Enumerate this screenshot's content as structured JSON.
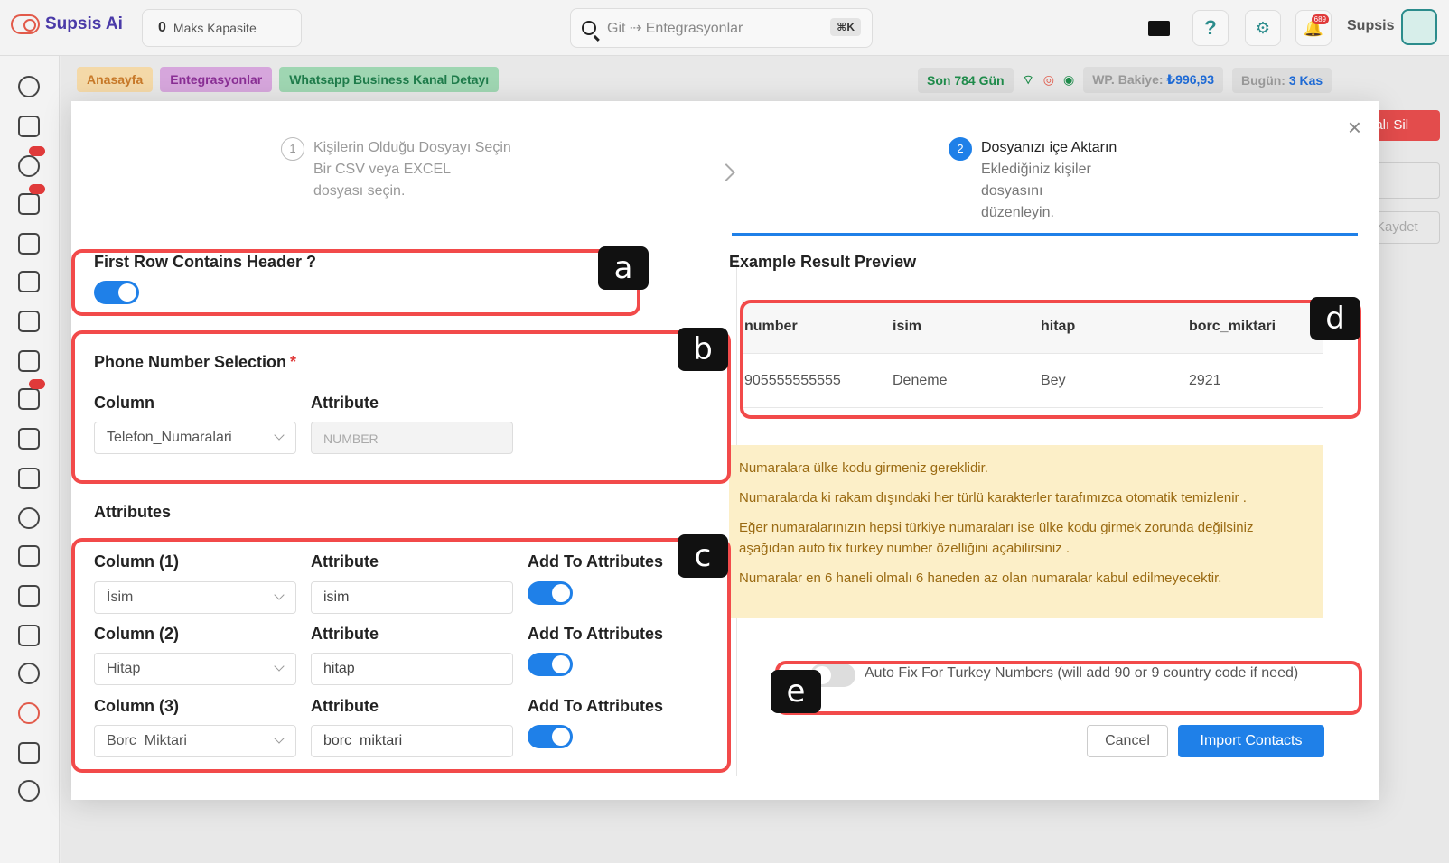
{
  "topbar": {
    "brand": "Supsis Ai",
    "capacity_value": "0",
    "capacity_label": "Maks Kapasite",
    "search_value": "Git ⇢ Entegrasyonlar",
    "search_shortcut": "⌘K",
    "notif_count": "689",
    "user_name": "Supsis"
  },
  "breadcrumbs": [
    "Anasayfa",
    "Entegrasyonlar",
    "Whatsapp Business Kanal Detayı"
  ],
  "status": {
    "days": "Son 784 Gün",
    "wp_balance_label": "WP. Bakiye:",
    "wp_balance_value": "₺996,93",
    "today_label": "Bugün:",
    "today_value": "3 Kas"
  },
  "background": {
    "delete_button": "nalı Sil",
    "save_button": "Kaydet"
  },
  "modal": {
    "steps": [
      {
        "num": "1",
        "title": "Kişilerin Olduğu Dosyayı Seçin",
        "desc": "Bir CSV veya EXCEL dosyası seçin."
      },
      {
        "num": "2",
        "title": "Dosyanızı içe Aktarın",
        "desc": "Eklediğiniz kişiler dosyasını düzenleyin."
      }
    ],
    "header_toggle_label": "First Row Contains Header ?",
    "phone_section_title": "Phone Number Selection",
    "required_mark": "*",
    "column_label": "Column",
    "attribute_label": "Attribute",
    "phone_column_value": "Telefon_Numaralari",
    "phone_attribute_placeholder": "NUMBER",
    "attributes_title": "Attributes",
    "add_to_attributes_label": "Add To Attributes",
    "attribute_rows": [
      {
        "column_label": "Column (1)",
        "column_value": "İsim",
        "attribute_value": "isim"
      },
      {
        "column_label": "Column (2)",
        "column_value": "Hitap",
        "attribute_value": "hitap"
      },
      {
        "column_label": "Column (3)",
        "column_value": "Borc_Miktari",
        "attribute_value": "borc_miktari"
      }
    ],
    "preview_title": "Example Result Preview",
    "preview_headers": [
      "number",
      "isim",
      "hitap",
      "borc_miktari"
    ],
    "preview_row": [
      "905555555555",
      "Deneme",
      "Bey",
      "2921"
    ],
    "warnings": [
      "Numaralara ülke kodu girmeniz gereklidir.",
      "Numaralarda ki rakam dışındaki her türlü karakterler tarafımızca otomatik temizlenir .",
      "Eğer numaralarınızın hepsi türkiye numaraları ise ülke kodu girmek zorunda değilsiniz aşağıdan auto fix turkey number özelliğini açabilirsiniz .",
      "Numaralar en 6 haneli olmalı 6 haneden az olan numaralar kabul edilmeyecektir."
    ],
    "auto_fix_label": "Auto Fix For Turkey Numbers (will add 90 or 9 country code if need)",
    "cancel_button": "Cancel",
    "import_button": "Import Contacts",
    "close_symbol": "×"
  },
  "annotations": [
    "a",
    "b",
    "c",
    "d",
    "e"
  ],
  "colors": {
    "accent": "#1f80e8",
    "highlight": "#f24a4a",
    "warning_bg": "#fcefc8"
  }
}
